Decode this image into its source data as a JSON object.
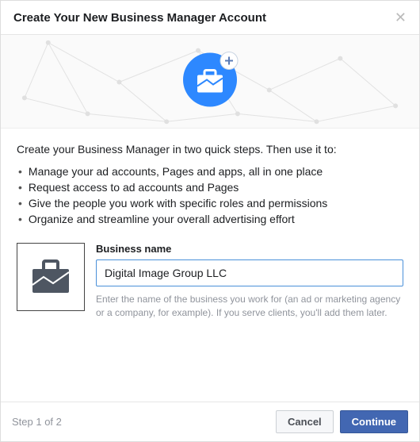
{
  "header": {
    "title": "Create Your New Business Manager Account"
  },
  "intro": "Create your Business Manager in two quick steps. Then use it to:",
  "bullets": [
    "Manage your ad accounts, Pages and apps, all in one place",
    "Request access to ad accounts and Pages",
    "Give the people you work with specific roles and permissions",
    "Organize and streamline your overall advertising effort"
  ],
  "form": {
    "label": "Business name",
    "value": "Digital Image Group LLC",
    "hint": "Enter the name of the business you work for (an ad or marketing agency or a company, for example). If you serve clients, you'll add them later."
  },
  "footer": {
    "step": "Step 1 of 2",
    "cancel": "Cancel",
    "continue": "Continue"
  },
  "colors": {
    "primary": "#4267b2",
    "accent_circle": "#2d88ff"
  }
}
